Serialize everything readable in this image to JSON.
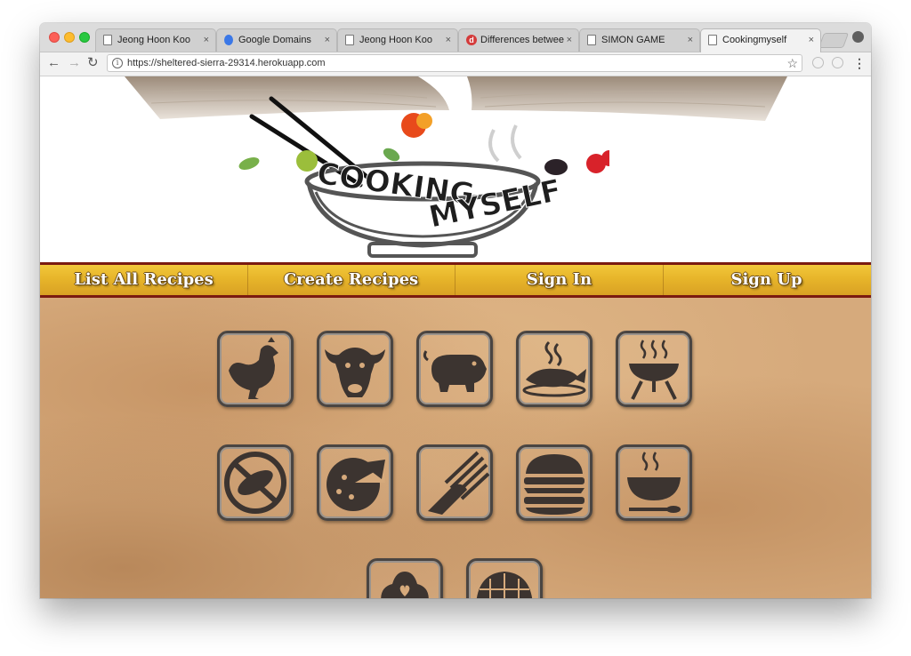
{
  "browser": {
    "tabs": [
      {
        "title": "Jeong Hoon Koo",
        "icon": "page-icon"
      },
      {
        "title": "Google Domains",
        "icon": "globe-icon"
      },
      {
        "title": "Jeong Hoon Koo",
        "icon": "page-icon"
      },
      {
        "title": "Differences betwee",
        "icon": "d-icon"
      },
      {
        "title": "SIMON GAME",
        "icon": "page-icon"
      },
      {
        "title": "Cookingmyself",
        "icon": "page-icon",
        "active": true
      }
    ],
    "close_glyph": "×",
    "url": "https://sheltered-sierra-29314.herokuapp.com",
    "back_glyph": "←",
    "forward_glyph": "→",
    "reload_glyph": "↻",
    "info_glyph": "i",
    "star_glyph": "☆",
    "menu_glyph": "⋮",
    "d_glyph": "d"
  },
  "site": {
    "logo_line1": "COOKING",
    "logo_line2": "MYSELF",
    "nav": [
      {
        "label": "List All Recipes"
      },
      {
        "label": "Create Recipes"
      },
      {
        "label": "Sign In"
      },
      {
        "label": "Sign Up"
      }
    ],
    "categories": [
      {
        "name": "chicken-icon"
      },
      {
        "name": "beef-icon"
      },
      {
        "name": "pork-icon"
      },
      {
        "name": "seafood-icon"
      },
      {
        "name": "bbq-icon"
      },
      {
        "name": "no-meat-icon"
      },
      {
        "name": "pizza-icon"
      },
      {
        "name": "pasta-icon"
      },
      {
        "name": "burger-icon"
      },
      {
        "name": "soup-icon"
      },
      {
        "name": "dessert-icon"
      },
      {
        "name": "pie-icon"
      }
    ],
    "colors": {
      "nav_bg": "#e7b52a",
      "nav_border": "#7a1a10",
      "parchment": "#d6aa7c",
      "icon_fill": "#3c3430"
    }
  }
}
